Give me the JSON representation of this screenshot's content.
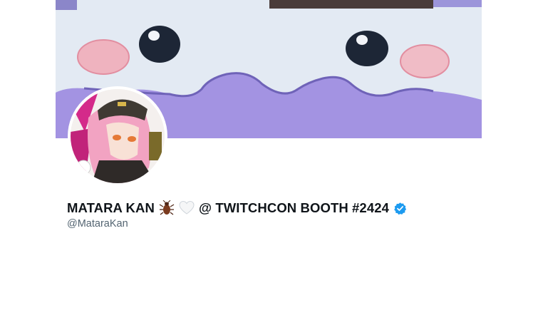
{
  "profile": {
    "display_name_prefix": "MATARA KAN",
    "display_name_suffix": "@ TWITCHCON BOOTH #2424",
    "handle": "@MataraKan",
    "verified": true,
    "emojis": [
      "cockroach-emoji",
      "white-heart-emoji"
    ]
  },
  "colors": {
    "banner_top": "#e2e9f3",
    "banner_purple": "#9f8fe0",
    "text_primary": "#0f1419",
    "text_secondary": "#536471",
    "verified_blue": "#1d9bf0"
  }
}
